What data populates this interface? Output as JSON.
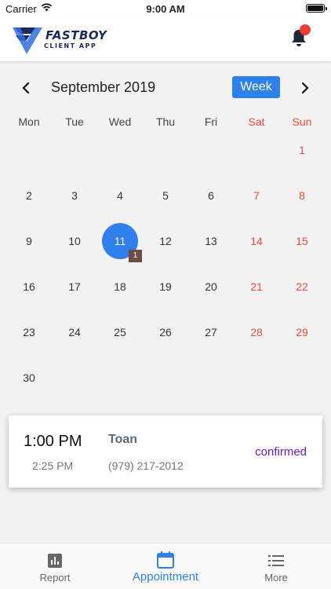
{
  "status_bar": {
    "carrier": "Carrier",
    "time": "9:00 AM"
  },
  "header": {
    "logo_text": "FASTBOY",
    "logo_subtext": "CLIENT APP",
    "icons": [
      "logo-icon",
      "bell-icon"
    ],
    "accent": "#1b2a5a",
    "notification_color": "#ef3b36"
  },
  "calendar": {
    "month_label": "September 2019",
    "view_button": "Week",
    "weekdays": [
      "Mon",
      "Tue",
      "Wed",
      "Thu",
      "Fri",
      "Sat",
      "Sun"
    ],
    "weeks": [
      [
        "",
        "",
        "",
        "",
        "",
        "",
        "1"
      ],
      [
        "2",
        "3",
        "4",
        "5",
        "6",
        "7",
        "8"
      ],
      [
        "9",
        "10",
        "11",
        "12",
        "13",
        "14",
        "15"
      ],
      [
        "16",
        "17",
        "18",
        "19",
        "20",
        "21",
        "22"
      ],
      [
        "23",
        "24",
        "25",
        "26",
        "27",
        "28",
        "29"
      ],
      [
        "30",
        "",
        "",
        "",
        "",
        "",
        ""
      ]
    ],
    "selected_day": "11",
    "event_badge": "1",
    "selected_color": "#2f80ed",
    "weekend_color": "#e74c3c"
  },
  "appointment": {
    "start_time": "1:00 PM",
    "end_time": "2:25 PM",
    "client_name": "Toan",
    "phone": "(979) 217-2012",
    "status": "confirmed",
    "status_color": "#6a1bb0"
  },
  "tabbar": {
    "tabs": [
      {
        "label": "Report",
        "icon": "bar-chart-icon",
        "active": false
      },
      {
        "label": "Appointment",
        "icon": "calendar-icon",
        "active": true
      },
      {
        "label": "More",
        "icon": "list-icon",
        "active": false
      }
    ],
    "active_color": "#2f80ed",
    "inactive_color": "#666666"
  }
}
